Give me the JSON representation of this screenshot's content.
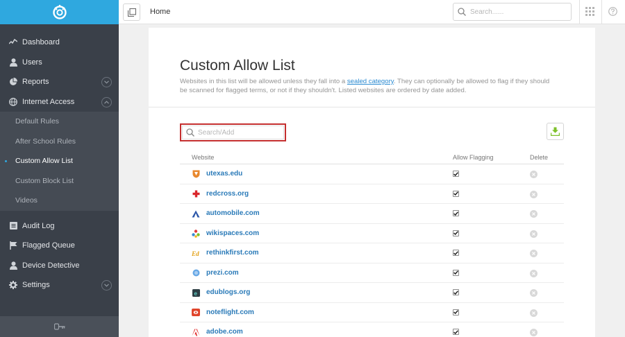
{
  "sidebar": {
    "items": [
      {
        "label": "Dashboard",
        "icon": "activity-icon"
      },
      {
        "label": "Users",
        "icon": "user-icon"
      },
      {
        "label": "Reports",
        "icon": "pie-chart-icon"
      },
      {
        "label": "Internet Access",
        "icon": "globe-icon"
      }
    ],
    "sub_items": [
      {
        "label": "Default Rules"
      },
      {
        "label": "After School Rules"
      },
      {
        "label": "Custom Allow List",
        "active": true
      },
      {
        "label": "Custom Block List"
      },
      {
        "label": "Videos"
      }
    ],
    "lower_items": [
      {
        "label": "Audit Log",
        "icon": "log-icon"
      },
      {
        "label": "Flagged Queue",
        "icon": "flag-icon"
      },
      {
        "label": "Device Detective",
        "icon": "user-icon"
      },
      {
        "label": "Settings",
        "icon": "gear-icon"
      }
    ]
  },
  "topbar": {
    "breadcrumb": "Home",
    "search_placeholder": "Search......"
  },
  "page": {
    "title": "Custom Allow List",
    "desc_part1": "Websites in this list will be allowed unless they fall into a ",
    "desc_link": "sealed category",
    "desc_part2": ". They can optionally be allowed to flag if they should be scanned for flagged terms, or not if they shouldn't. Listed websites are ordered by date added.",
    "search_placeholder": "Search/Add"
  },
  "table": {
    "columns": [
      "Website",
      "Allow Flagging",
      "Delete"
    ],
    "rows": [
      {
        "site": "utexas.edu",
        "icon": "utexas-favicon",
        "color": "#e8882e",
        "flag": true
      },
      {
        "site": "redcross.org",
        "icon": "redcross-favicon",
        "color": "#d9262b",
        "flag": true
      },
      {
        "site": "automobile.com",
        "icon": "automobile-favicon",
        "color": "#2b56a8",
        "flag": true
      },
      {
        "site": "wikispaces.com",
        "icon": "wikispaces-favicon",
        "color": "#3a8bd2",
        "flag": true
      },
      {
        "site": "rethinkfirst.com",
        "icon": "rethinkfirst-favicon",
        "color": "#e3a21a",
        "flag": true
      },
      {
        "site": "prezi.com",
        "icon": "prezi-favicon",
        "color": "#67a8e6",
        "flag": true
      },
      {
        "site": "edublogs.org",
        "icon": "edublogs-favicon",
        "color": "#2d3e44",
        "flag": true
      },
      {
        "site": "noteflight.com",
        "icon": "noteflight-favicon",
        "color": "#e0452b",
        "flag": true
      },
      {
        "site": "adobe.com",
        "icon": "adobe-favicon",
        "color": "#e12828",
        "flag": true
      }
    ]
  },
  "colors": {
    "sidebar_bg": "#3a4049",
    "brand_bg": "#2fa8df",
    "link": "#2a7ab8",
    "highlight": "#c42f2f"
  }
}
